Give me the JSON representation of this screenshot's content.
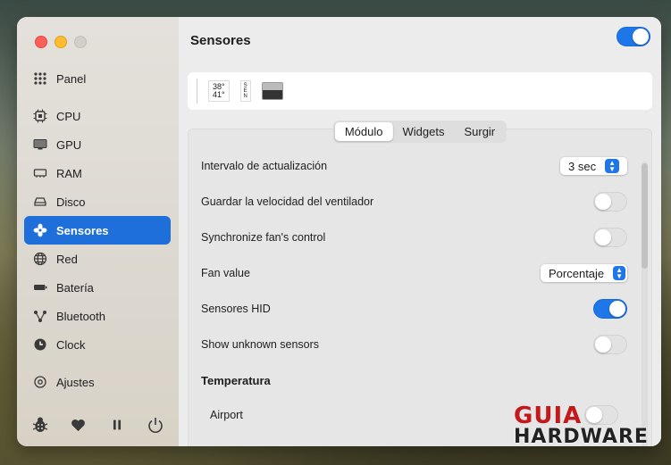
{
  "window": {
    "title": "Sensores",
    "module_enabled": true
  },
  "sidebar": {
    "items": [
      {
        "label": "Panel",
        "icon": "grid-icon"
      },
      {
        "label": "CPU",
        "icon": "cpu-icon"
      },
      {
        "label": "GPU",
        "icon": "display-icon"
      },
      {
        "label": "RAM",
        "icon": "memory-icon"
      },
      {
        "label": "Disco",
        "icon": "disk-icon"
      },
      {
        "label": "Sensores",
        "icon": "fan-icon",
        "active": true
      },
      {
        "label": "Red",
        "icon": "globe-icon"
      },
      {
        "label": "Batería",
        "icon": "battery-icon"
      },
      {
        "label": "Bluetooth",
        "icon": "bluetooth-icon"
      },
      {
        "label": "Clock",
        "icon": "clock-icon"
      },
      {
        "label": "Ajustes",
        "icon": "gear-icon"
      }
    ],
    "bottom_icons": [
      "bug-icon",
      "heart-icon",
      "pause-icon",
      "power-icon"
    ]
  },
  "widgets": {
    "temp_top": "38°",
    "temp_bottom": "41°",
    "fan_letters": "S E N"
  },
  "tabs": [
    {
      "label": "Módulo",
      "selected": true
    },
    {
      "label": "Widgets",
      "selected": false
    },
    {
      "label": "Surgir",
      "selected": false
    }
  ],
  "settings": {
    "update_interval": {
      "label": "Intervalo de actualización",
      "value": "3 sec"
    },
    "save_fan_speed": {
      "label": "Guardar la velocidad del ventilador",
      "on": false
    },
    "sync_fan": {
      "label": "Synchronize fan's control",
      "on": false
    },
    "fan_value": {
      "label": "Fan value",
      "value": "Porcentaje"
    },
    "hid_sensors": {
      "label": "Sensores HID",
      "on": true
    },
    "unknown_sensors": {
      "label": "Show unknown sensors",
      "on": false
    }
  },
  "temperature": {
    "section_title": "Temperatura",
    "airport_label": "Airport",
    "airport_on": false
  },
  "watermark": {
    "line1": "GUIA",
    "line2": "HARDWARE"
  },
  "colors": {
    "accent": "#1e76e8",
    "sidebar_active": "#1e6fd9"
  }
}
